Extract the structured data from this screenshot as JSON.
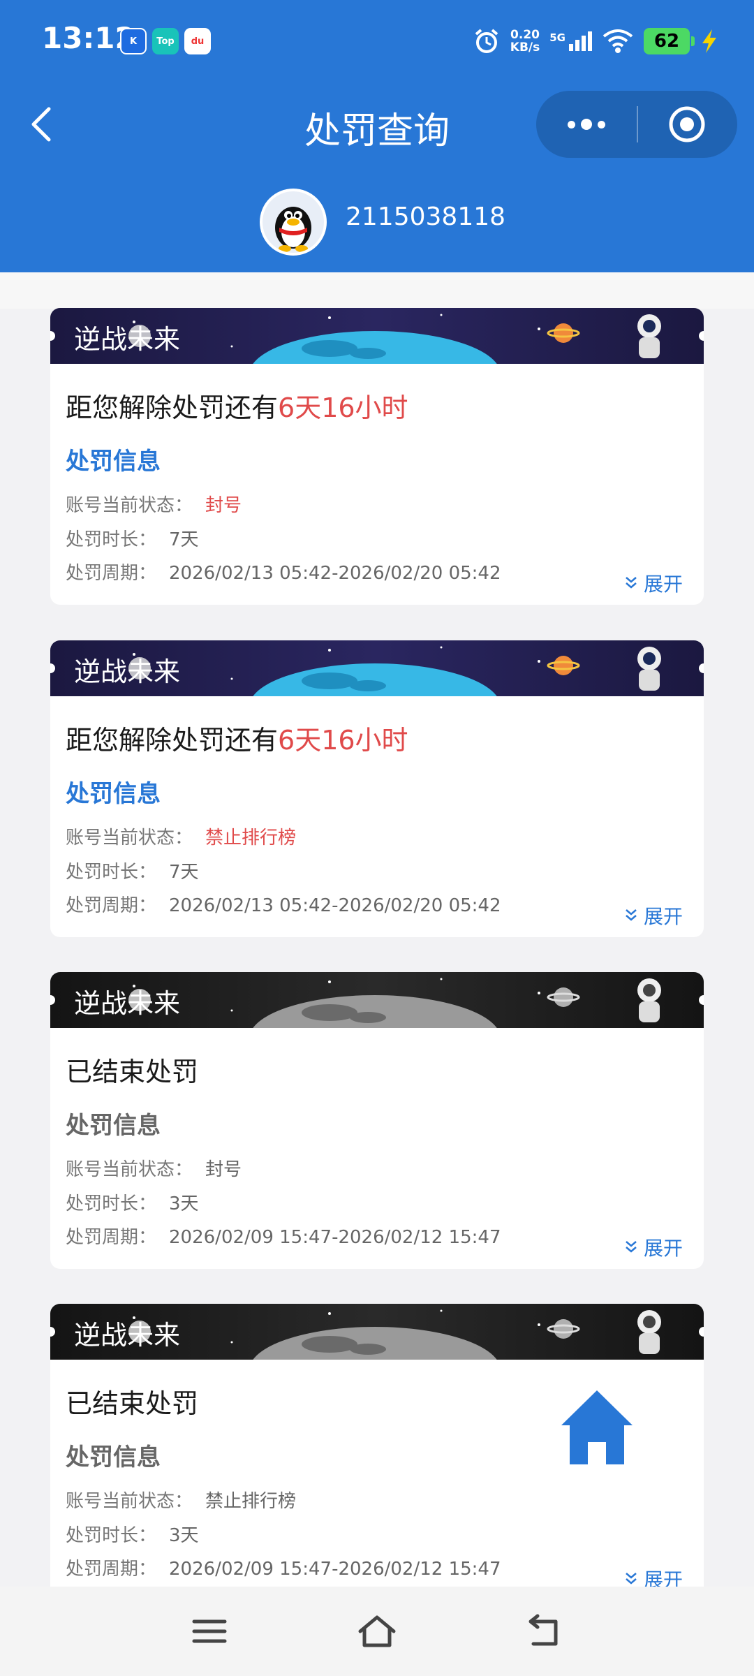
{
  "status_bar": {
    "time": "13:12",
    "app_icons": [
      "K",
      "Top",
      "du"
    ],
    "net_speed_value": "0.20",
    "net_speed_unit": "KB/s",
    "network": "5G",
    "battery": "62"
  },
  "header": {
    "title": "处罚查询",
    "account": "2115038118",
    "accent_color": "#2877d6"
  },
  "cards": [
    {
      "banner": "逆战未来",
      "headline_prefix": "距您解除处罚还有",
      "headline_countdown": "6天16小时",
      "info_title": "处罚信息",
      "status_label": "账号当前状态：",
      "status_value": "封号",
      "duration_label": "处罚时长：",
      "duration_value": "7天",
      "period_label": "处罚周期：",
      "period_value": "2026/02/13 05:42-2026/02/20 05:42",
      "expand": "展开"
    },
    {
      "banner": "逆战未来",
      "headline_prefix": "距您解除处罚还有",
      "headline_countdown": "6天16小时",
      "info_title": "处罚信息",
      "status_label": "账号当前状态：",
      "status_value": "禁止排行榜",
      "duration_label": "处罚时长：",
      "duration_value": "7天",
      "period_label": "处罚周期：",
      "period_value": "2026/02/13 05:42-2026/02/20 05:42",
      "expand": "展开"
    },
    {
      "banner": "逆战未来",
      "headline_prefix": "已结束处罚",
      "headline_countdown": "",
      "info_title": "处罚信息",
      "status_label": "账号当前状态：",
      "status_value": "封号",
      "duration_label": "处罚时长：",
      "duration_value": "3天",
      "period_label": "处罚周期：",
      "period_value": "2026/02/09 15:47-2026/02/12 15:47",
      "expand": "展开"
    },
    {
      "banner": "逆战未来",
      "headline_prefix": "已结束处罚",
      "headline_countdown": "",
      "info_title": "处罚信息",
      "status_label": "账号当前状态：",
      "status_value": "禁止排行榜",
      "duration_label": "处罚时长：",
      "duration_value": "3天",
      "period_label": "处罚周期：",
      "period_value": "2026/02/09 15:47-2026/02/12 15:47",
      "expand": "展开"
    }
  ],
  "icons": {
    "back": "chevron-left-icon",
    "more": "more-dots-icon",
    "close": "target-circle-icon",
    "home_fab": "home-icon",
    "expand": "double-chevron-down-icon",
    "nav_menu": "menu-icon",
    "nav_home": "home-outline-icon",
    "nav_back": "back-arrow-icon"
  }
}
